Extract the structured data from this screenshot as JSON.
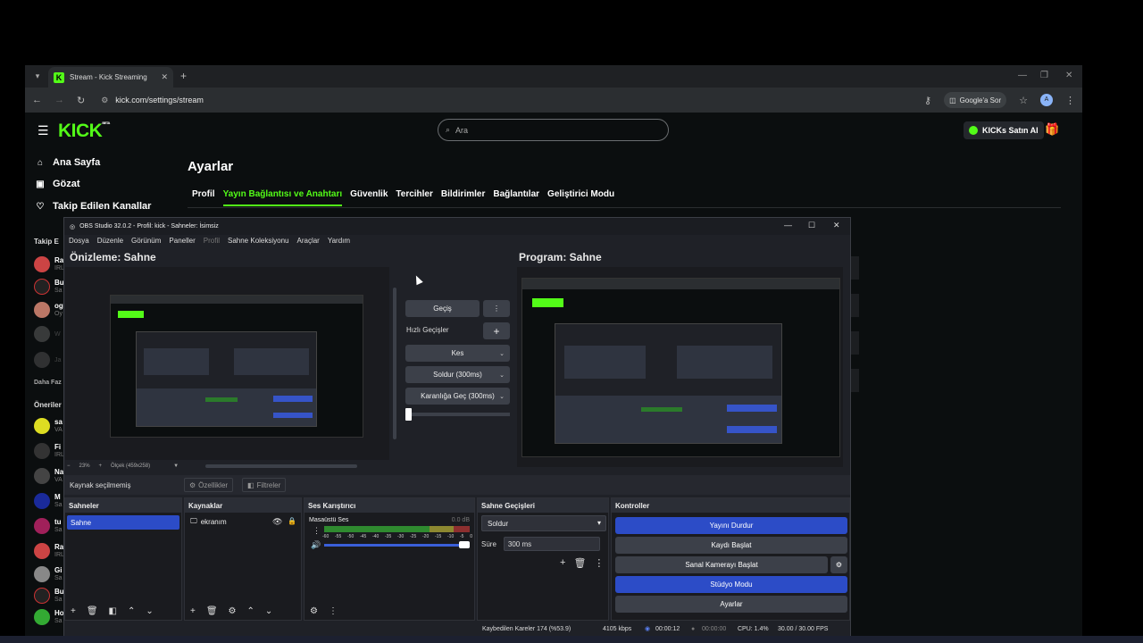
{
  "browser": {
    "tab_title": "Stream - Kick Streaming",
    "url": "kick.com/settings/stream",
    "ask_google": "Google'a Sor",
    "profile_initial": "A"
  },
  "kick": {
    "logo": "KICK",
    "logo_sup": "BETA",
    "search_placeholder": "Ara",
    "buy_kicks": "KICKs Satın Al",
    "nav": [
      {
        "label": "Ana Sayfa",
        "icon": "home-icon"
      },
      {
        "label": "Gözat",
        "icon": "browse-icon"
      },
      {
        "label": "Takip Edilen Kanallar",
        "icon": "heart-icon"
      }
    ],
    "followed_header": "Takip E",
    "recommended_header": "Öneriler",
    "browse_more": "Daha Faz",
    "followed": [
      {
        "name": "Ra",
        "sub": "IRL"
      },
      {
        "name": "Bu",
        "sub": "Sa"
      },
      {
        "name": "og",
        "sub": "Oy"
      },
      {
        "name": "",
        "sub": "W"
      },
      {
        "name": "",
        "sub": "Ja"
      }
    ],
    "recommended": [
      {
        "name": "sa",
        "sub": "VA"
      },
      {
        "name": "Fi",
        "sub": "IRL"
      },
      {
        "name": "Na",
        "sub": "VA"
      },
      {
        "name": "M",
        "sub": "Sa"
      },
      {
        "name": "tu",
        "sub": "Sa"
      },
      {
        "name": "Ra",
        "sub": "IRL"
      },
      {
        "name": "Gi",
        "sub": "Sa"
      },
      {
        "name": "Bu",
        "sub": "Sa"
      },
      {
        "name": "Ho",
        "sub": "Sa"
      }
    ],
    "settings_title": "Ayarlar",
    "settings_tabs": [
      "Profil",
      "Yayın Bağlantısı ve Anahtarı",
      "Güvenlik",
      "Tercihler",
      "Bildirimler",
      "Bağlantılar",
      "Geliştirici Modu"
    ]
  },
  "obs": {
    "title": "OBS Studio 32.0.2 - Profil: kick - Sahneler: İsimsiz",
    "menu": [
      "Dosya",
      "Düzenle",
      "Görünüm",
      "Paneller",
      "Profil",
      "Sahne Koleksiyonu",
      "Araçlar",
      "Yardım"
    ],
    "preview_title": "Önizleme: Sahne",
    "program_title": "Program: Sahne",
    "transition_button": "Geçiş",
    "quick_transitions": "Hızlı Geçişler",
    "quick_list": [
      "Kes",
      "Soldur (300ms)",
      "Karanlığa Geç (300ms)"
    ],
    "zoom": "23%",
    "scale": "Ölçek (459x258)",
    "no_source": "Kaynak seçilmemiş",
    "properties": "Özellikler",
    "filters": "Filtreler",
    "scenes_header": "Sahneler",
    "scene": "Sahne",
    "sources_header": "Kaynaklar",
    "source": "ekranım",
    "mixer_header": "Ses Karıştırıcı",
    "mixer_channel": "Masaüstü Ses",
    "mixer_db": "0.0 dB",
    "mixer_ticks": [
      "-60",
      "-55",
      "-50",
      "-45",
      "-40",
      "-35",
      "-30",
      "-25",
      "-20",
      "-15",
      "-10",
      "-5",
      "0"
    ],
    "transitions_header": "Sahne Geçişleri",
    "transition_select": "Soldur",
    "duration_label": "Süre",
    "duration_value": "300 ms",
    "controls_header": "Kontroller",
    "controls": {
      "stop_stream": "Yayını Durdur",
      "start_record": "Kaydı Başlat",
      "start_vcam": "Sanal Kamerayı Başlat",
      "studio_mode": "Stüdyo Modu",
      "settings": "Ayarlar"
    },
    "status": {
      "dropped": "Kaybedilen Kareler 174 (%53.9)",
      "bitrate": "4105 kbps",
      "stream_time": "00:00:12",
      "rec_time": "00:00:00",
      "cpu": "CPU: 1.4%",
      "fps": "30.00 / 30.00 FPS"
    }
  },
  "colors": {
    "kick_green": "#53fc18",
    "obs_blue": "#2c4cc7"
  }
}
